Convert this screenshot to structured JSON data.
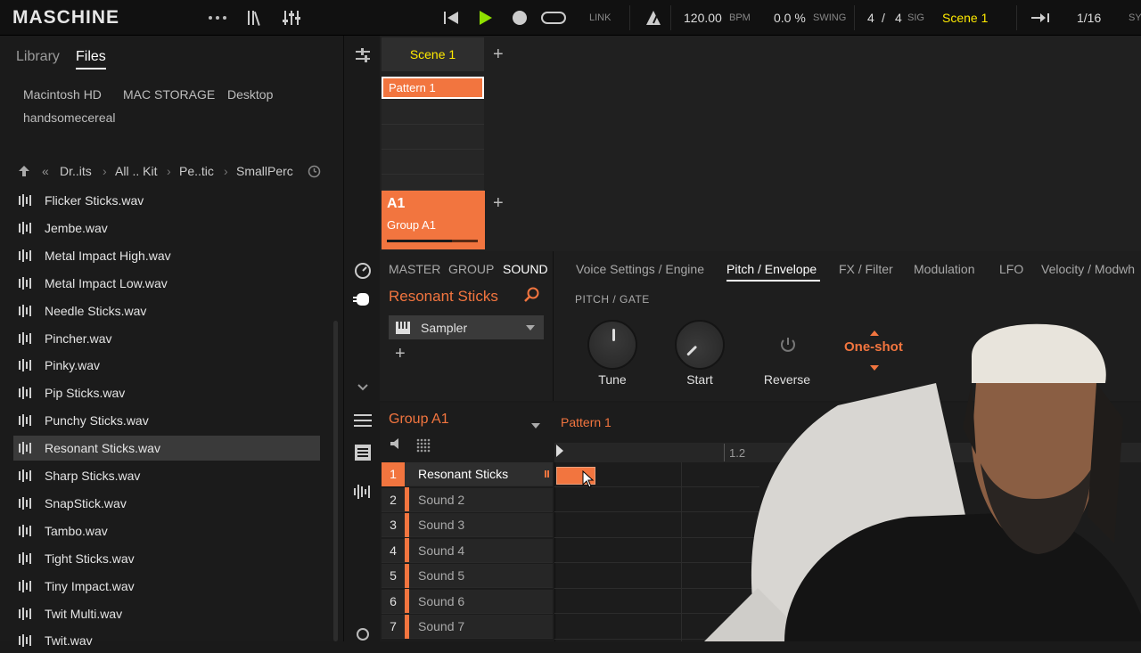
{
  "app": {
    "title": "MASCHINE"
  },
  "transport": {
    "tempo": "120.00",
    "tempo_unit": "BPM",
    "swing": "0.0 %",
    "swing_label": "SWING",
    "sig_num": "4",
    "sig_sep": "/",
    "sig_den": "4",
    "sig_label": "SIG",
    "scene": "Scene 1",
    "quantize": "1/16",
    "link": "LINK",
    "sync": "SYN"
  },
  "browser": {
    "tabs": [
      "Library",
      "Files"
    ],
    "locations": [
      "Macintosh HD",
      "MAC STORAGE",
      "Desktop",
      "handsomecereal"
    ],
    "breadcrumb": [
      "Dr..its",
      "All .. Kit",
      "Pe..tic",
      "SmallPerc"
    ],
    "files": [
      "Flicker Sticks.wav",
      "Jembe.wav",
      "Metal Impact High.wav",
      "Metal Impact Low.wav",
      "Needle Sticks.wav",
      "Pincher.wav",
      "Pinky.wav",
      "Pip Sticks.wav",
      "Punchy Sticks.wav",
      "Resonant Sticks.wav",
      "Sharp Sticks.wav",
      "SnapStick.wav",
      "Tambo.wav",
      "Tight Sticks.wav",
      "Tiny Impact.wav",
      "Twit Multi.wav",
      "Twit.wav"
    ],
    "selected_index": 9
  },
  "arranger": {
    "scene_tab": "Scene 1",
    "pattern": "Pattern 1",
    "group_code": "A1",
    "group_name": "Group A1",
    "group_level": 0.72
  },
  "control": {
    "levels": [
      "MASTER",
      "GROUP",
      "SOUND"
    ],
    "active_level": "SOUND",
    "sound_name": "Resonant Sticks",
    "plugin": "Sampler",
    "tabs": [
      "Voice Settings / Engine",
      "Pitch / Envelope",
      "FX / Filter",
      "Modulation",
      "LFO",
      "Velocity / Modwh"
    ],
    "active_tab": "Pitch / Envelope",
    "section": "PITCH / GATE",
    "params": {
      "tune": "Tune",
      "start": "Start",
      "reverse": "Reverse",
      "mode": "One-shot"
    }
  },
  "pattern_editor": {
    "group": "Group A1",
    "pattern": "Pattern 1",
    "ruler_mark": "1.2",
    "sounds": [
      {
        "num": "1",
        "name": "Resonant Sticks"
      },
      {
        "num": "2",
        "name": "Sound 2"
      },
      {
        "num": "3",
        "name": "Sound 3"
      },
      {
        "num": "4",
        "name": "Sound 4"
      },
      {
        "num": "5",
        "name": "Sound 5"
      },
      {
        "num": "6",
        "name": "Sound 6"
      },
      {
        "num": "7",
        "name": "Sound 7"
      }
    ]
  },
  "colors": {
    "accent": "#f2753f",
    "highlight": "#ffea00"
  }
}
